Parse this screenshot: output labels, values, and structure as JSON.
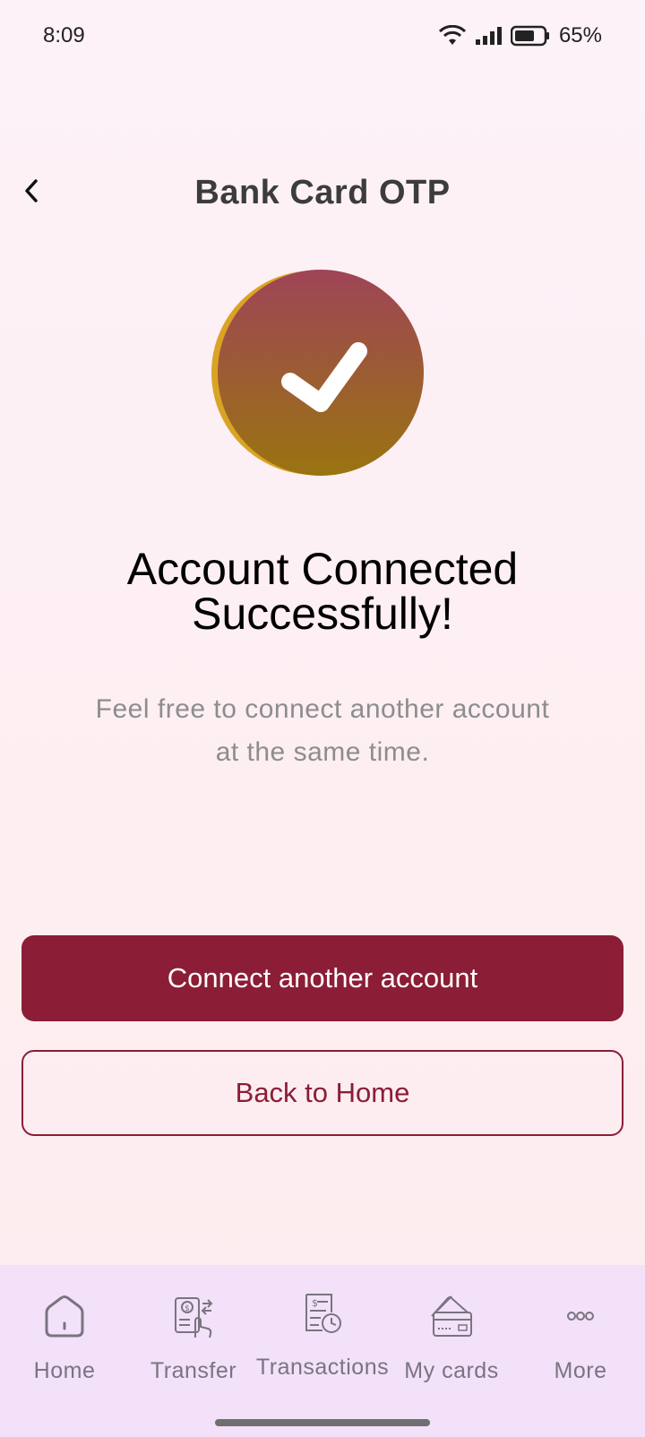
{
  "status_bar": {
    "time": "8:09",
    "battery_percent": "65%"
  },
  "header": {
    "title": "Bank Card OTP"
  },
  "success": {
    "heading_line1": "Account Connected",
    "heading_line2": "Successfully!",
    "subtext_line1": "Feel free to connect another account",
    "subtext_line2": "at the same time."
  },
  "actions": {
    "primary_label": "Connect another account",
    "secondary_label": "Back to Home"
  },
  "bottom_nav": {
    "items": [
      {
        "label": "Home",
        "icon": "home-icon"
      },
      {
        "label": "Transfer",
        "icon": "transfer-icon"
      },
      {
        "label": "Transactions",
        "icon": "transactions-icon"
      },
      {
        "label": "My cards",
        "icon": "cards-icon"
      },
      {
        "label": "More",
        "icon": "more-icon"
      }
    ]
  },
  "colors": {
    "brand": "#8b1d36",
    "icon_gradient_top": "#9e4457",
    "icon_gradient_bottom": "#9a7410",
    "icon_shadow": "#d9a425",
    "nav_background": "#f2e1f8"
  }
}
